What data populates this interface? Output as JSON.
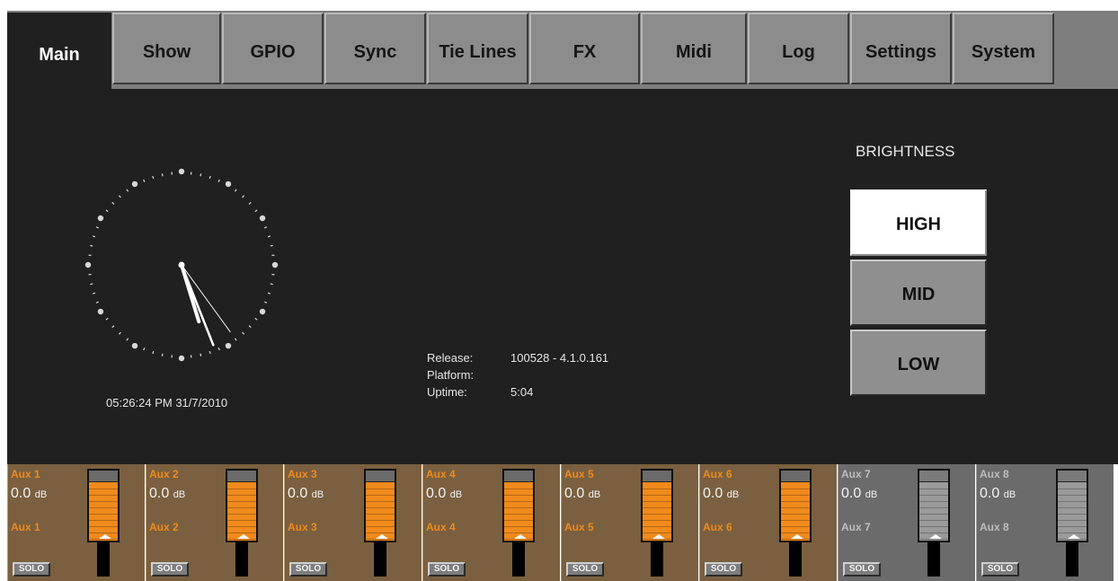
{
  "tabs": [
    {
      "label": "Main",
      "active": true
    },
    {
      "label": "Show",
      "active": false
    },
    {
      "label": "GPIO",
      "active": false
    },
    {
      "label": "Sync",
      "active": false
    },
    {
      "label": "Tie Lines",
      "active": false
    },
    {
      "label": "FX",
      "active": false
    },
    {
      "label": "Midi",
      "active": false
    },
    {
      "label": "Log",
      "active": false
    },
    {
      "label": "Settings",
      "active": false
    },
    {
      "label": "System",
      "active": false
    }
  ],
  "clock": {
    "datetime_text": "05:26:24 PM  31/7/2010",
    "hour": 5,
    "minute": 26,
    "second": 24
  },
  "info": {
    "release_label": "Release:",
    "release_value": "100528 - 4.1.0.161",
    "platform_label": "Platform:",
    "platform_value": "",
    "uptime_label": "Uptime:",
    "uptime_value": "5:04"
  },
  "brightness": {
    "title": "BRIGHTNESS",
    "options": [
      "HIGH",
      "MID",
      "LOW"
    ],
    "selected": "HIGH"
  },
  "strips": [
    {
      "name": "Aux 1",
      "value": "0.0",
      "unit": "dB",
      "subname": "Aux 1",
      "solo": "SOLO",
      "color": "orange"
    },
    {
      "name": "Aux 2",
      "value": "0.0",
      "unit": "dB",
      "subname": "Aux 2",
      "solo": "SOLO",
      "color": "orange"
    },
    {
      "name": "Aux 3",
      "value": "0.0",
      "unit": "dB",
      "subname": "Aux 3",
      "solo": "SOLO",
      "color": "orange"
    },
    {
      "name": "Aux 4",
      "value": "0.0",
      "unit": "dB",
      "subname": "Aux 4",
      "solo": "SOLO",
      "color": "orange"
    },
    {
      "name": "Aux 5",
      "value": "0.0",
      "unit": "dB",
      "subname": "Aux 5",
      "solo": "SOLO",
      "color": "orange"
    },
    {
      "name": "Aux 6",
      "value": "0.0",
      "unit": "dB",
      "subname": "Aux 6",
      "solo": "SOLO",
      "color": "orange"
    },
    {
      "name": "Aux 7",
      "value": "0.0",
      "unit": "dB",
      "subname": "Aux 7",
      "solo": "SOLO",
      "color": "grey"
    },
    {
      "name": "Aux 8",
      "value": "0.0",
      "unit": "dB",
      "subname": "Aux 8",
      "solo": "SOLO",
      "color": "grey"
    }
  ],
  "colors": {
    "background": "#202020",
    "tab": "#8c8c8c",
    "strip_orange": "#7a6040",
    "strip_grey": "#6b6b6b",
    "fader_orange": "#f08a1c",
    "fader_grey": "#9a9a9a"
  }
}
